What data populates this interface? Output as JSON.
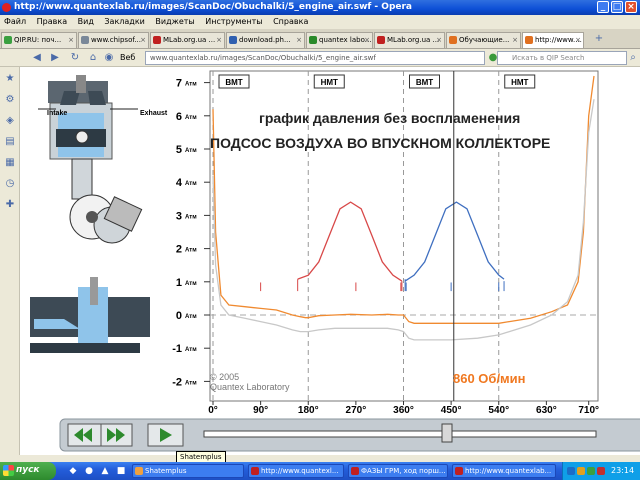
{
  "window": {
    "title": "http://www.quantexlab.ru/images/ScanDoc/Obuchalki/5_engine_air.swf - Opera",
    "controls": [
      "_",
      "□",
      "×"
    ]
  },
  "menu": [
    "Файл",
    "Правка",
    "Вид",
    "Закладки",
    "Виджеты",
    "Инструменты",
    "Справка"
  ],
  "tabs": [
    {
      "label": "QIP.RU: поч...",
      "color": "#3aa040"
    },
    {
      "label": "www.chipsof...",
      "color": "#7a8899"
    },
    {
      "label": "MLab.org.ua ...",
      "color": "#c02020"
    },
    {
      "label": "download.ph...",
      "color": "#3060b0"
    },
    {
      "label": "quantex labo...",
      "color": "#2a8a2a"
    },
    {
      "label": "MLab.org.ua ...",
      "color": "#c02020"
    },
    {
      "label": "Обучающие...",
      "color": "#e07020"
    },
    {
      "label": "http://www....",
      "color": "#e07020",
      "active": true
    }
  ],
  "nav": {
    "address": "www.quantexlab.ru/images/ScanDoc/Obuchalki/5_engine_air.swf",
    "page_label": "Веб",
    "search_placeholder": "Искать в QIP Search"
  },
  "animation": {
    "intake_label": "Intake",
    "exhaust_label": "Exhaust",
    "title_line1": "график давления без воспламенения",
    "title_line2": "ПОДСОС ВОЗДУХА ВО ВПУСКНОМ КОЛЛЕКТОРЕ",
    "copyright_line1": "© 2005",
    "copyright_line2": "Quantex Laboratory",
    "rpm": "860 Об/мин",
    "unit_suffix": "Атм",
    "dead_centers": [
      "ВМТ",
      "НМТ",
      "ВМТ",
      "НМТ"
    ],
    "controls": {
      "rewind": "rewind",
      "fast_forward": "fast-forward",
      "play": "play"
    },
    "slider_position_fraction": 0.62,
    "tooltip": "Shatemplus"
  },
  "chart_data": {
    "type": "line",
    "xlabel": "",
    "ylabel": "",
    "x_ticks": [
      "0°",
      "90°",
      "180°",
      "270°",
      "360°",
      "450°",
      "540°",
      "630°",
      "710°"
    ],
    "y_ticks": [
      "7",
      "6",
      "5",
      "4",
      "3",
      "2",
      "1",
      "0",
      "-1",
      "-2"
    ],
    "ylim": [
      -2,
      7
    ],
    "xlim": [
      0,
      720
    ],
    "dead_center_x": [
      0,
      180,
      360,
      540
    ],
    "cursor_x": 455,
    "colors": {
      "actual": "#f08a30",
      "reference": "#c8c8c8",
      "compression": "#d84848",
      "expansion": "#3f6fc0",
      "rpm": "#f07820"
    },
    "series": [
      {
        "id": "actual",
        "x": [
          0,
          5,
          15,
          30,
          60,
          90,
          120,
          150,
          165,
          175,
          180,
          200,
          230,
          260,
          300,
          330,
          350,
          360,
          370,
          380,
          400,
          450,
          500,
          540,
          560,
          600,
          640,
          670,
          690,
          700,
          710,
          720
        ],
        "y": [
          6.2,
          2.5,
          0.6,
          0.3,
          0.25,
          0.2,
          0.15,
          0.0,
          -0.05,
          -0.08,
          -0.08,
          -0.02,
          0.0,
          0.02,
          0.0,
          0.02,
          0.0,
          0.0,
          -0.2,
          -0.25,
          -0.25,
          -0.25,
          -0.25,
          -0.25,
          -0.2,
          -0.1,
          0.1,
          0.3,
          1.0,
          2.5,
          6.0,
          7.2
        ]
      },
      {
        "id": "reference",
        "x": [
          0,
          5,
          15,
          30,
          60,
          90,
          120,
          150,
          165,
          175,
          180,
          200,
          230,
          260,
          300,
          330,
          350,
          360,
          370,
          380,
          400,
          450,
          500,
          540,
          560,
          600,
          640,
          670,
          690,
          700,
          710,
          720
        ],
        "y": [
          4.2,
          1.5,
          0.3,
          0.0,
          -0.1,
          -0.2,
          -0.3,
          -0.45,
          -0.5,
          -0.5,
          -0.5,
          -0.45,
          -0.4,
          -0.4,
          -0.4,
          -0.4,
          -0.45,
          -0.5,
          -0.7,
          -0.75,
          -0.75,
          -0.75,
          -0.7,
          -0.6,
          -0.5,
          -0.3,
          0.0,
          0.4,
          1.2,
          2.8,
          5.5,
          6.5
        ]
      },
      {
        "id": "compression",
        "x": [
          160,
          180,
          200,
          220,
          240,
          260,
          280,
          300,
          320,
          340,
          357
        ],
        "y": [
          1.08,
          1.2,
          1.6,
          2.4,
          3.2,
          3.4,
          3.2,
          2.4,
          1.6,
          1.2,
          1.02
        ]
      },
      {
        "id": "expansion",
        "x": [
          363,
          380,
          400,
          420,
          440,
          460,
          480,
          500,
          520,
          540,
          550
        ],
        "y": [
          1.02,
          1.2,
          1.6,
          2.4,
          3.2,
          3.4,
          3.2,
          2.4,
          1.6,
          1.2,
          1.08
        ]
      }
    ],
    "marker_x": [
      90,
      270,
      355,
      365,
      450,
      540
    ]
  }
}
